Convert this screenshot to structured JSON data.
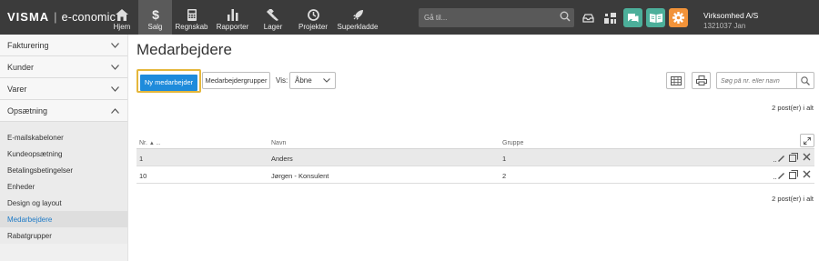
{
  "brand": {
    "logo": "VISMA",
    "product": "e-conomic"
  },
  "nav": [
    {
      "label": "Hjem",
      "icon": "home-icon"
    },
    {
      "label": "Salg",
      "icon": "dollar-icon",
      "active": true
    },
    {
      "label": "Regnskab",
      "icon": "calculator-icon"
    },
    {
      "label": "Rapporter",
      "icon": "bar-chart-icon"
    },
    {
      "label": "Lager",
      "icon": "forklift-icon"
    },
    {
      "label": "Projekter",
      "icon": "clock-icon"
    },
    {
      "label": "Superkladde",
      "icon": "rocket-icon"
    }
  ],
  "search": {
    "placeholder": "Gå til..."
  },
  "toolbar_icons": [
    "inbox-icon",
    "dashboard-icon",
    "chat-icon",
    "book-icon",
    "settings-gear-icon"
  ],
  "colors": {
    "topbar": "#3b3b3b",
    "accent_green": "#4caf9a",
    "accent_orange": "#f29339",
    "primary_blue": "#1e8bdb",
    "highlight_yellow": "#e5b73b",
    "link_blue": "#1f7bc7"
  },
  "company": {
    "name": "Virksomhed A/S",
    "id": "1321037 Jan"
  },
  "sidebar": {
    "groups": [
      {
        "label": "Fakturering",
        "expanded": false
      },
      {
        "label": "Kunder",
        "expanded": false
      },
      {
        "label": "Varer",
        "expanded": false
      },
      {
        "label": "Opsætning",
        "expanded": true
      }
    ],
    "links": [
      {
        "label": "E-mailskabeloner"
      },
      {
        "label": "Kundeopsætning"
      },
      {
        "label": "Betalingsbetingelser"
      },
      {
        "label": "Enheder"
      },
      {
        "label": "Design og layout"
      },
      {
        "label": "Medarbejdere",
        "active": true
      },
      {
        "label": "Rabatgrupper"
      }
    ]
  },
  "main": {
    "title": "Medarbejdere",
    "new_button": "Ny medarbejder",
    "groups_button": "Medarbejdergrupper",
    "vis_label": "Vis:",
    "vis_value": "Åbne",
    "search_placeholder": "Søg på nr. eller navn",
    "count_top": "2 post(er) i alt",
    "count_bottom": "2 post(er) i alt",
    "columns": {
      "nr": "Nr.",
      "navn": "Navn",
      "gruppe": "Gruppe"
    },
    "rows": [
      {
        "nr": "1",
        "navn": "Anders",
        "gruppe": "1"
      },
      {
        "nr": "10",
        "navn": "Jørgen - Konsulent",
        "gruppe": "2"
      }
    ]
  }
}
